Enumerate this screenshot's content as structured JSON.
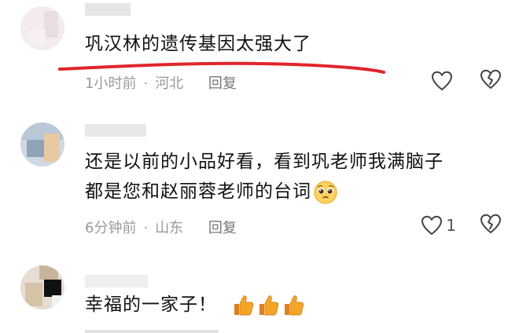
{
  "comments": [
    {
      "text": "巩汉林的遗传基因太强大了",
      "time": "1小时前",
      "location": "河北",
      "reply_label": "回复",
      "like_count": ""
    },
    {
      "text_line1": "还是以前的小品好看，看到巩老师我满脑子",
      "text_line2": "都是您和赵丽蓉老师的台词",
      "time": "6分钟前",
      "location": "山东",
      "reply_label": "回复",
      "like_count": "1",
      "emoji": "pleading-face"
    },
    {
      "text": "幸福的一家子！",
      "emoji": "thumbs-up x3"
    }
  ],
  "separator": "·",
  "icons": [
    "heart-outline-icon",
    "broken-heart-icon",
    "thumbs-up-emoji",
    "pleading-face-emoji"
  ],
  "colors": {
    "underline": "#e0262b",
    "meta": "#9a9a9a",
    "thumb": "#f5a524"
  }
}
